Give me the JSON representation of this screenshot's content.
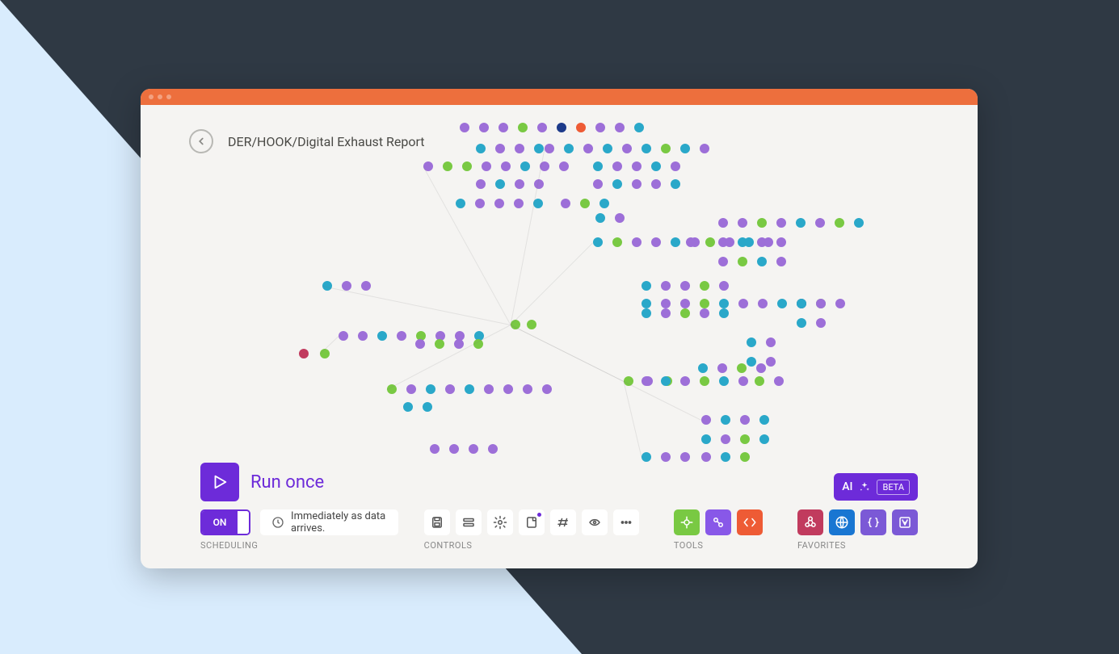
{
  "header": {
    "back_icon": "arrow-left",
    "title": "DER/HOOK/Digital Exhaust Report"
  },
  "run": {
    "label": "Run once"
  },
  "scheduling": {
    "section_label": "SCHEDULING",
    "toggle_on_label": "ON",
    "mode_text": "Immediately as data arrives."
  },
  "controls": {
    "section_label": "CONTROLS",
    "items": [
      {
        "name": "save-icon"
      },
      {
        "name": "align-icon"
      },
      {
        "name": "settings-icon"
      },
      {
        "name": "note-icon",
        "badge": true
      },
      {
        "name": "auto-align-icon"
      },
      {
        "name": "explain-icon"
      },
      {
        "name": "more-icon"
      }
    ]
  },
  "tools": {
    "section_label": "TOOLS",
    "items": [
      {
        "name": "module-icon",
        "color": "green"
      },
      {
        "name": "transform-icon",
        "color": "purple"
      },
      {
        "name": "code-icon",
        "color": "orange"
      }
    ]
  },
  "favorites": {
    "section_label": "FAVORITES",
    "items": [
      {
        "name": "webhook-icon",
        "color": "red"
      },
      {
        "name": "http-icon",
        "color": "blue"
      },
      {
        "name": "json-icon",
        "color": "violet"
      },
      {
        "name": "office-icon",
        "color": "violet"
      }
    ]
  },
  "ai": {
    "label": "AI",
    "badge": "BETA"
  },
  "canvas": {
    "colors": {
      "purple": "#9d6fd8",
      "green": "#79c943",
      "blue": "#3b8fd4",
      "teal": "#2aa8c9",
      "navy": "#1d3a8a",
      "orange": "#ee5b35",
      "red": "#c13b5e"
    }
  }
}
